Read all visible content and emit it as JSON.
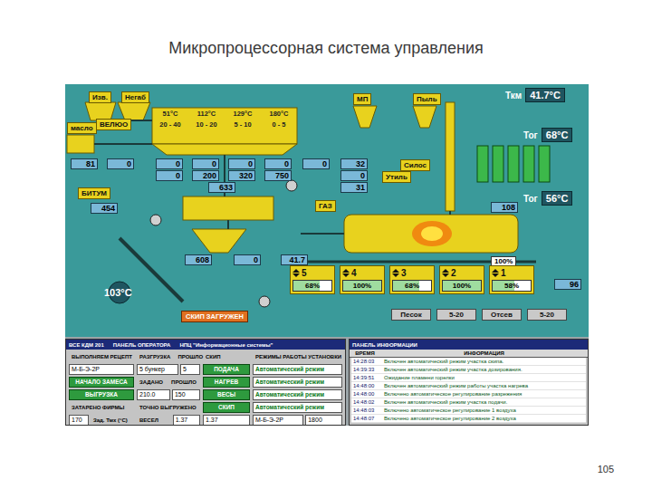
{
  "slide": {
    "title": "Микропроцессорная система управления",
    "page_number": "105"
  },
  "diagram": {
    "tags": [
      {
        "text": "Изв."
      },
      {
        "text": "Негаб"
      },
      {
        "text": "масло"
      },
      {
        "text": "ВЕЛЮО"
      },
      {
        "text": "БИТУМ"
      },
      {
        "text": "МП"
      },
      {
        "text": "Пыль"
      },
      {
        "text": "Силос"
      },
      {
        "text": "Утиль"
      },
      {
        "text": "ГАЗ"
      }
    ],
    "hot_bins": [
      {
        "temperature": "51°C",
        "fraction": "20 - 40"
      },
      {
        "temperature": "112°C",
        "fraction": "10 - 20"
      },
      {
        "temperature": "129°C",
        "fraction": "5 - 10"
      },
      {
        "temperature": "180°C",
        "fraction": "0 - 5"
      }
    ],
    "values": [
      "81",
      "0",
      "0",
      "0",
      "0",
      "0",
      "0",
      "200",
      "320",
      "750",
      "633",
      "0",
      "32",
      "0",
      "31",
      "454",
      "608",
      "0",
      "41.7",
      "108",
      "96"
    ],
    "temperatures": [
      {
        "label": "Ткм",
        "reading": "41.7°C"
      },
      {
        "label": "Тог",
        "reading": "68°C"
      },
      {
        "label": "Тог",
        "reading": "56°C"
      }
    ],
    "mixer_temperature": "103°C",
    "burner_output": "100%",
    "skip_status": "СКИП ЗАГРУЖЕН",
    "feeders": [
      {
        "number": "5",
        "reading": "68%",
        "level": 0.68
      },
      {
        "number": "4",
        "reading": "100%",
        "level": 1
      },
      {
        "number": "3",
        "reading": "68%",
        "level": 0.68
      },
      {
        "number": "2",
        "reading": "100%",
        "level": 1
      },
      {
        "number": "1",
        "reading": "58%",
        "level": 0.58
      }
    ],
    "materials": [
      {
        "text": "Песок"
      },
      {
        "text": "5-20"
      },
      {
        "text": "Отсев"
      },
      {
        "text": "5-20"
      }
    ]
  },
  "operator_panel": {
    "title": [
      "ВСЕ КДМ 201",
      "ПАНЕЛЬ ОПЕРАТОРА",
      "НПЦ \"Информационные системы\""
    ],
    "columns": [
      [
        [
          {
            "kind": "head",
            "text": "ВЫПОЛНЯЕМ РЕЦЕПТ"
          }
        ],
        [
          {
            "kind": "field",
            "text": "М-Б-Э-2Р"
          }
        ],
        [
          {
            "kind": "button",
            "text": "НАЧАЛО ЗАМЕСА"
          }
        ],
        [
          {
            "kind": "button",
            "text": "ВЫГРУЗКА"
          }
        ],
        [
          {
            "kind": "head",
            "text": "ЗАТАРЕНО ФИРМЫ"
          }
        ],
        [
          {
            "kind": "field",
            "text": "170"
          },
          {
            "kind": "head",
            "text": "Зад. Тмх (°C)"
          }
        ]
      ],
      [
        [
          {
            "kind": "head",
            "text": "РАЗГРУЗКА"
          },
          {
            "kind": "head",
            "text": "ПРОШЛО"
          }
        ],
        [
          {
            "kind": "field",
            "text": "5 бункер"
          },
          {
            "kind": "field",
            "text": "5"
          }
        ],
        [
          {
            "kind": "head",
            "text": "ЗАДАНО"
          },
          {
            "kind": "head",
            "text": "ПРОШЛО"
          }
        ],
        [
          {
            "kind": "field",
            "text": "210.0"
          },
          {
            "kind": "field",
            "text": "150"
          }
        ],
        [
          {
            "kind": "head",
            "text": "ТОЧНО ВЫГРУЖЕНО"
          }
        ],
        [
          {
            "kind": "head",
            "text": "ВЕСЕЛ"
          },
          {
            "kind": "field",
            "text": "1.37"
          }
        ]
      ],
      [
        [
          {
            "kind": "head",
            "text": "СКИП"
          }
        ],
        [
          {
            "kind": "button",
            "text": "ПОДАЧА"
          }
        ],
        [
          {
            "kind": "button",
            "text": "НАГРЕВ"
          }
        ],
        [
          {
            "kind": "button",
            "text": "ВЕСЫ"
          }
        ],
        [
          {
            "kind": "button",
            "text": "СКИП"
          }
        ],
        [
          {
            "kind": "field",
            "text": "1.37"
          }
        ]
      ],
      [
        [
          {
            "kind": "head",
            "text": "РЕЖИМЫ РАБОТЫ УСТАНОВКИ"
          }
        ],
        [
          {
            "kind": "mode",
            "text": "Автоматический режим"
          }
        ],
        [
          {
            "kind": "mode",
            "text": "Автоматический режим"
          }
        ],
        [
          {
            "kind": "mode",
            "text": "Автоматический режим"
          }
        ],
        [
          {
            "kind": "mode",
            "text": "Автоматический режим"
          }
        ],
        [
          {
            "kind": "field",
            "text": "М-Б-Э-2Р"
          },
          {
            "kind": "field",
            "text": "1800"
          }
        ]
      ]
    ]
  },
  "info_panel": {
    "title": "ПАНЕЛЬ ИНФОРМАЦИИ",
    "columns": [
      "ВРЕМЯ",
      "ИНФОРМАЦИЯ"
    ],
    "rows": [
      {
        "time": "14:28:03",
        "message": "Включен автоматический режим участка скипа."
      },
      {
        "time": "14:39:33",
        "message": "Включен автоматический режим участка дозирования."
      },
      {
        "time": "14:39:51",
        "message": "Ожидание пламени горелки"
      },
      {
        "time": "14:48:00",
        "message": "Включен автоматический режим работы участка нагрева"
      },
      {
        "time": "14:48:00",
        "message": "Включено автоматическое регулирование разрежения"
      },
      {
        "time": "14:48:02",
        "message": "Включен автоматический режим участка подачи."
      },
      {
        "time": "14:48:03",
        "message": "Включено автоматическое регулирование 1 воздуха"
      },
      {
        "time": "14:48:07",
        "message": "Включено автоматическое регулирование 2 воздуха"
      }
    ]
  }
}
